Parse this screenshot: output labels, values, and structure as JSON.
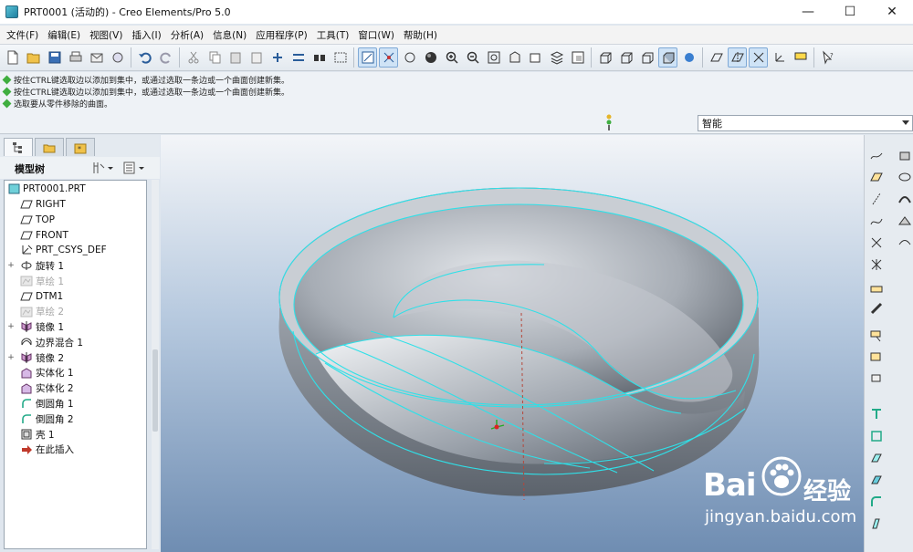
{
  "window": {
    "title": "PRT0001 (活动的) - Creo Elements/Pro 5.0",
    "controls": [
      "—",
      "☐",
      "✕"
    ]
  },
  "menu": [
    "文件(F)",
    "编辑(E)",
    "视图(V)",
    "插入(I)",
    "分析(A)",
    "信息(N)",
    "应用程序(P)",
    "工具(T)",
    "窗口(W)",
    "帮助(H)"
  ],
  "messages": [
    "按住CTRL键选取边以添加到集中，或通过选取一条边或一个曲面创建新集。",
    "按住CTRL键选取边以添加到集中，或通过选取一条边或一个曲面创建新集。",
    "选取要从零件移除的曲面。"
  ],
  "filter": {
    "value": "智能"
  },
  "tree": {
    "title": "模型树",
    "root": "PRT0001.PRT",
    "items": [
      {
        "label": "RIGHT",
        "icon": "datum-plane-icon",
        "dim": false,
        "exp": ""
      },
      {
        "label": "TOP",
        "icon": "datum-plane-icon",
        "dim": false,
        "exp": ""
      },
      {
        "label": "FRONT",
        "icon": "datum-plane-icon",
        "dim": false,
        "exp": ""
      },
      {
        "label": "PRT_CSYS_DEF",
        "icon": "csys-icon",
        "dim": false,
        "exp": ""
      },
      {
        "label": "旋转 1",
        "icon": "revolve-icon",
        "dim": false,
        "exp": "+"
      },
      {
        "label": "草绘 1",
        "icon": "sketch-icon",
        "dim": true,
        "exp": ""
      },
      {
        "label": "DTM1",
        "icon": "datum-plane-icon",
        "dim": false,
        "exp": ""
      },
      {
        "label": "草绘 2",
        "icon": "sketch-icon",
        "dim": true,
        "exp": ""
      },
      {
        "label": "镜像 1",
        "icon": "mirror-icon",
        "dim": false,
        "exp": "+"
      },
      {
        "label": "边界混合 1",
        "icon": "boundary-blend-icon",
        "dim": false,
        "exp": ""
      },
      {
        "label": "镜像 2",
        "icon": "mirror-icon",
        "dim": false,
        "exp": "+"
      },
      {
        "label": "实体化 1",
        "icon": "solidify-icon",
        "dim": false,
        "exp": ""
      },
      {
        "label": "实体化 2",
        "icon": "solidify-icon",
        "dim": false,
        "exp": ""
      },
      {
        "label": "倒圆角 1",
        "icon": "round-icon",
        "dim": false,
        "exp": ""
      },
      {
        "label": "倒圆角 2",
        "icon": "round-icon",
        "dim": false,
        "exp": ""
      },
      {
        "label": "壳 1",
        "icon": "shell-icon",
        "dim": false,
        "exp": ""
      },
      {
        "label": "在此插入",
        "icon": "insert-here-icon",
        "dim": false,
        "exp": ""
      }
    ]
  },
  "watermark": {
    "brand": "Bai",
    "brand2": "经验",
    "url": "jingyan.baidu.com"
  }
}
